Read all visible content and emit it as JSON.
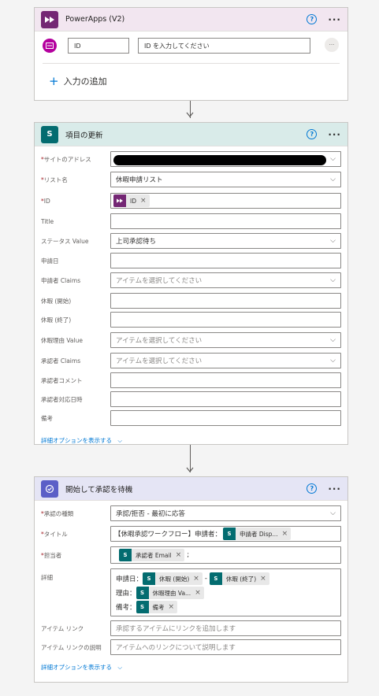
{
  "powerapps": {
    "title": "PowerApps (V2)",
    "icon": "powerapps-icon",
    "id_label": "ID",
    "id_placeholder": "ID を入力してください",
    "add_input": "入力の追加",
    "color": "#742774"
  },
  "update": {
    "title": "項目の更新",
    "icon": "sharepoint-icon",
    "color": "#036c70",
    "fields": [
      {
        "label": "サイトのアドレス",
        "required": "*",
        "value": ""
      },
      {
        "label": "リスト名",
        "required": "*",
        "value": "休暇申請リスト"
      },
      {
        "label": "ID",
        "required": "*",
        "token": "ID"
      },
      {
        "label": "Title",
        "value": ""
      },
      {
        "label": "ステータス Value",
        "value": "上司承認待ち"
      },
      {
        "label": "申請日",
        "value": ""
      },
      {
        "label": "申請者 Claims",
        "placeholder": "アイテムを選択してください"
      },
      {
        "label": "休暇 (開始)",
        "value": ""
      },
      {
        "label": "休暇 (終了)",
        "value": ""
      },
      {
        "label": "休暇理由 Value",
        "placeholder": "アイテムを選択してください"
      },
      {
        "label": "承認者 Claims",
        "placeholder": "アイテムを選択してください"
      },
      {
        "label": "承認者コメント",
        "value": ""
      },
      {
        "label": "承認者対応日時",
        "value": ""
      },
      {
        "label": "備考",
        "value": ""
      }
    ],
    "advanced": "詳細オプションを表示する"
  },
  "approval": {
    "title": "開始して承認を待機",
    "icon": "approval-icon",
    "color": "#5b5fc7",
    "type_label": "承認の種類",
    "type_value": "承認/拒否 - 最初に応答",
    "title_label": "タイトル",
    "title_prefix": "【休暇承認ワークフロー】申請者：",
    "title_token": "申請者 Disp...",
    "assignee_label": "担当者",
    "assignee_token": "承認者 Email",
    "assignee_suffix": ";",
    "details_label": "詳細",
    "line1_prefix": "申請日：",
    "line1_token1": "休暇 (開始)",
    "line1_sep": "-",
    "line1_token2": "休暇 (終了)",
    "line2_prefix": "理由：",
    "line2_token": "休暇理由 Va...",
    "line3_prefix": "備考：",
    "line3_token": "備考",
    "item_link_label": "アイテム リンク",
    "item_link_placeholder": "承認するアイテムにリンクを追加します",
    "item_link_desc_label": "アイテム リンクの説明",
    "item_link_desc_placeholder": "アイテムへのリンクについて説明します",
    "advanced": "詳細オプションを表示する"
  },
  "common": {
    "help": "?",
    "more": "···",
    "close": "×",
    "chevron": "⌵",
    "required": "*",
    "add_icon": "+"
  }
}
